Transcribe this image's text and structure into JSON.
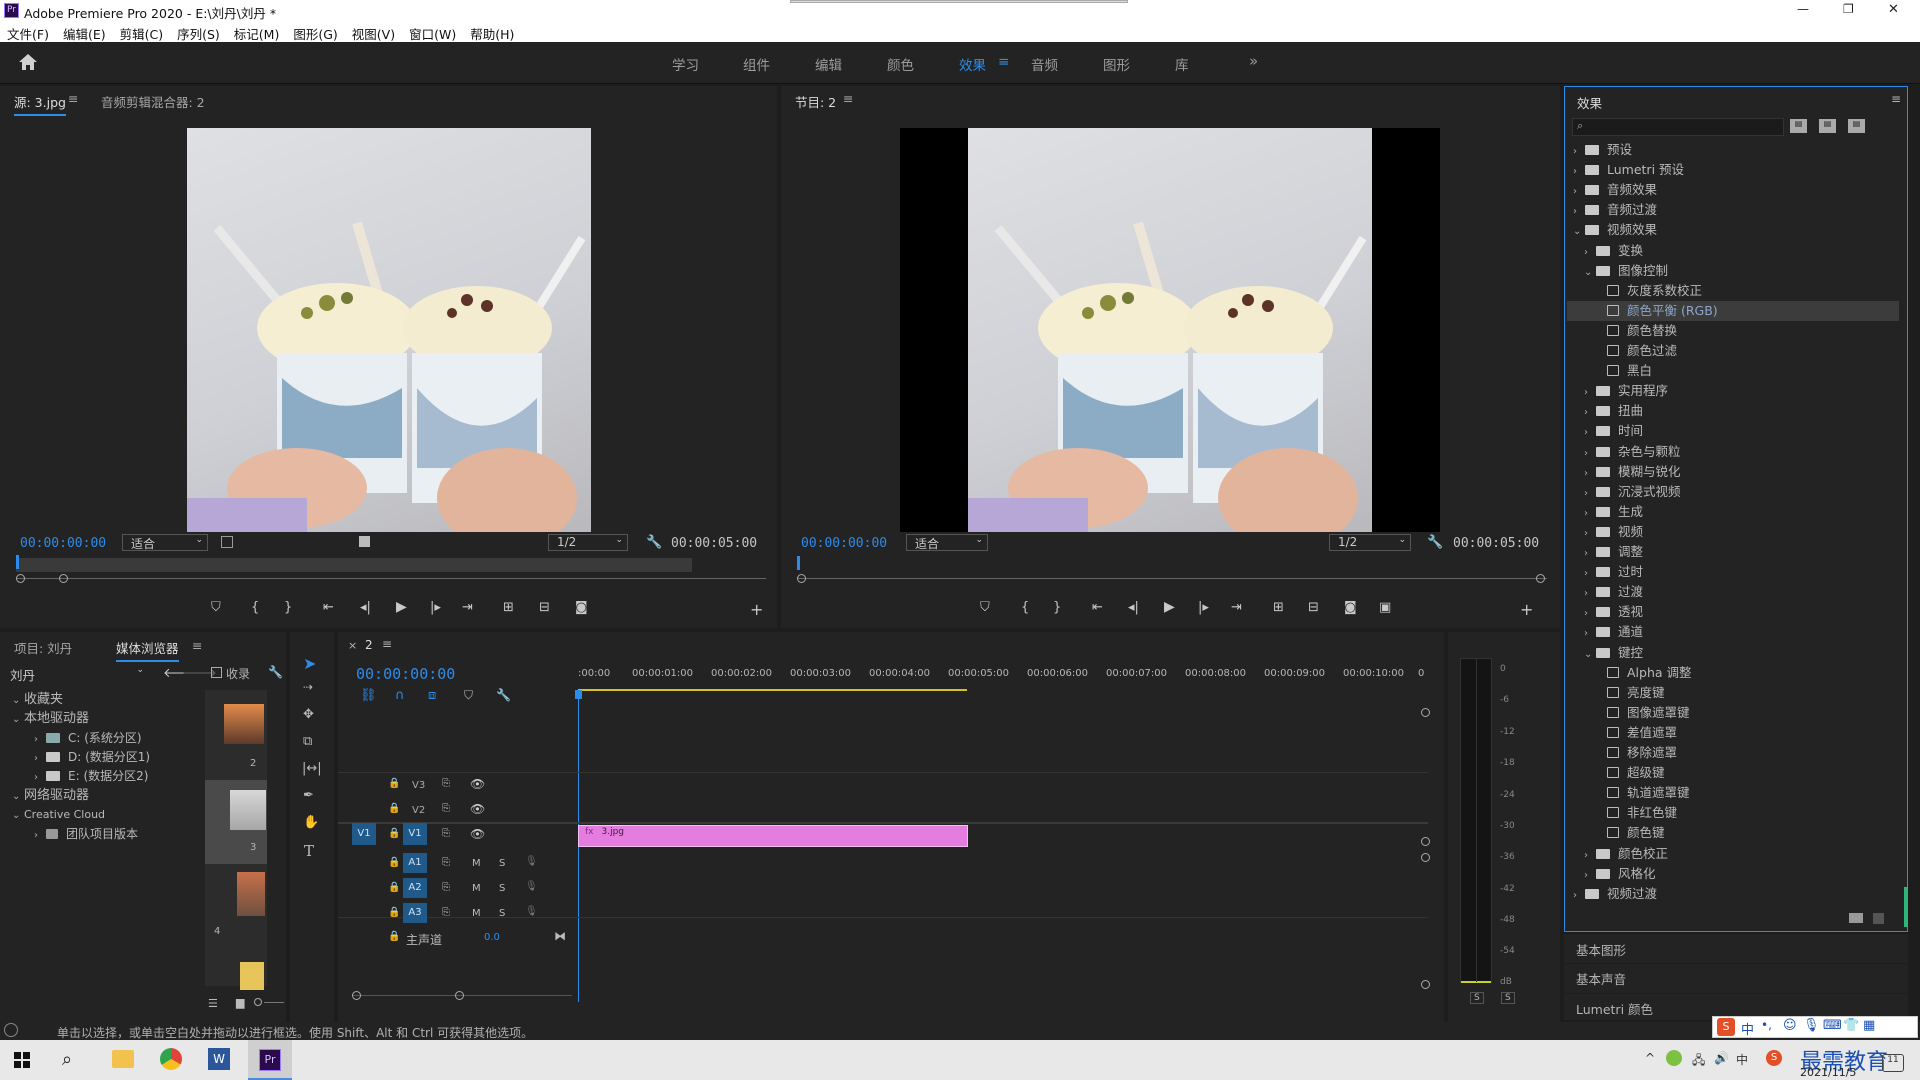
{
  "window": {
    "title": "Adobe Premiere Pro 2020 - E:\\刘丹\\刘丹 *",
    "controls": [
      "—",
      "❐",
      "✕"
    ]
  },
  "menu": [
    "文件(F)",
    "编辑(E)",
    "剪辑(C)",
    "序列(S)",
    "标记(M)",
    "图形(G)",
    "视图(V)",
    "窗口(W)",
    "帮助(H)"
  ],
  "workspaces": [
    "学习",
    "组件",
    "编辑",
    "颜色",
    "效果",
    "音频",
    "图形",
    "库"
  ],
  "active_workspace": "效果",
  "source": {
    "tab": "源: 3.jpg",
    "tab2": "音频剪辑混合器: 2",
    "timecode": "00:00:00:00",
    "fit": "适合",
    "res": "1/2",
    "duration": "00:00:05:00"
  },
  "program": {
    "tab": "节目: 2",
    "timecode": "00:00:00:00",
    "fit": "适合",
    "res": "1/2",
    "duration": "00:00:05:00"
  },
  "project": {
    "tab1": "项目: 刘丹",
    "tab2": "媒体浏览器",
    "location": "刘丹",
    "fav_label": "收录",
    "tree": [
      {
        "label": "收藏夹",
        "level": 0,
        "expanded": true
      },
      {
        "label": "本地驱动器",
        "level": 0,
        "expanded": true
      },
      {
        "label": "C: (系统分区)",
        "level": 1
      },
      {
        "label": "D: (数据分区1)",
        "level": 1
      },
      {
        "label": "E: (数据分区2)",
        "level": 1
      },
      {
        "label": "网络驱动器",
        "level": 0,
        "expanded": true
      },
      {
        "label": "Creative Cloud",
        "level": 0,
        "expanded": true
      },
      {
        "label": "团队项目版本",
        "level": 1
      }
    ],
    "thumb_nums": [
      "2",
      "3",
      "4"
    ]
  },
  "timeline": {
    "tab": "2",
    "timecode": "00:00:00:00",
    "ruler": [
      ":00:00",
      "00:00:01:00",
      "00:00:02:00",
      "00:00:03:00",
      "00:00:04:00",
      "00:00:05:00",
      "00:00:06:00",
      "00:00:07:00",
      "00:00:08:00",
      "00:00:09:00",
      "00:00:10:00",
      "0"
    ],
    "video_tracks": [
      "V3",
      "V2",
      "V1"
    ],
    "audio_tracks": [
      "A1",
      "A2",
      "A3"
    ],
    "master": "主声道",
    "master_val": "0.0",
    "clip": "3.jpg",
    "src_patch": "V1",
    "M": "M",
    "S": "S",
    "fx": "fx"
  },
  "meter": {
    "db": [
      "0",
      "-6",
      "-12",
      "-18",
      "-24",
      "-30",
      "-36",
      "-42",
      "-48",
      "-54",
      "dB"
    ],
    "solo": [
      "S",
      "S"
    ]
  },
  "effects": {
    "title": "效果",
    "items": [
      {
        "label": "预设",
        "level": 0,
        "type": "folder",
        "open": false
      },
      {
        "label": "Lumetri 预设",
        "level": 0,
        "type": "folder",
        "open": false
      },
      {
        "label": "音频效果",
        "level": 0,
        "type": "folder",
        "open": false
      },
      {
        "label": "音频过渡",
        "level": 0,
        "type": "folder",
        "open": false
      },
      {
        "label": "视频效果",
        "level": 0,
        "type": "folder",
        "open": true
      },
      {
        "label": "变换",
        "level": 1,
        "type": "folder",
        "open": false
      },
      {
        "label": "图像控制",
        "level": 1,
        "type": "folder",
        "open": true
      },
      {
        "label": "灰度系数校正",
        "level": 2,
        "type": "fx"
      },
      {
        "label": "颜色平衡 (RGB)",
        "level": 2,
        "type": "fx",
        "selected": true
      },
      {
        "label": "颜色替换",
        "level": 2,
        "type": "fx"
      },
      {
        "label": "颜色过滤",
        "level": 2,
        "type": "fx"
      },
      {
        "label": "黑白",
        "level": 2,
        "type": "fx"
      },
      {
        "label": "实用程序",
        "level": 1,
        "type": "folder",
        "open": false
      },
      {
        "label": "扭曲",
        "level": 1,
        "type": "folder",
        "open": false
      },
      {
        "label": "时间",
        "level": 1,
        "type": "folder",
        "open": false
      },
      {
        "label": "杂色与颗粒",
        "level": 1,
        "type": "folder",
        "open": false
      },
      {
        "label": "模糊与锐化",
        "level": 1,
        "type": "folder",
        "open": false
      },
      {
        "label": "沉浸式视频",
        "level": 1,
        "type": "folder",
        "open": false
      },
      {
        "label": "生成",
        "level": 1,
        "type": "folder",
        "open": false
      },
      {
        "label": "视频",
        "level": 1,
        "type": "folder",
        "open": false
      },
      {
        "label": "调整",
        "level": 1,
        "type": "folder",
        "open": false
      },
      {
        "label": "过时",
        "level": 1,
        "type": "folder",
        "open": false
      },
      {
        "label": "过渡",
        "level": 1,
        "type": "folder",
        "open": false
      },
      {
        "label": "透视",
        "level": 1,
        "type": "folder",
        "open": false
      },
      {
        "label": "通道",
        "level": 1,
        "type": "folder",
        "open": false
      },
      {
        "label": "键控",
        "level": 1,
        "type": "folder",
        "open": true
      },
      {
        "label": "Alpha 调整",
        "level": 2,
        "type": "fx"
      },
      {
        "label": "亮度键",
        "level": 2,
        "type": "fx"
      },
      {
        "label": "图像遮罩键",
        "level": 2,
        "type": "fx"
      },
      {
        "label": "差值遮罩",
        "level": 2,
        "type": "fx"
      },
      {
        "label": "移除遮罩",
        "level": 2,
        "type": "fx"
      },
      {
        "label": "超级键",
        "level": 2,
        "type": "fx"
      },
      {
        "label": "轨道遮罩键",
        "level": 2,
        "type": "fx"
      },
      {
        "label": "非红色键",
        "level": 2,
        "type": "fx"
      },
      {
        "label": "颜色键",
        "level": 2,
        "type": "fx"
      },
      {
        "label": "颜色校正",
        "level": 1,
        "type": "folder",
        "open": false
      },
      {
        "label": "风格化",
        "level": 1,
        "type": "folder",
        "open": false
      },
      {
        "label": "视频过渡",
        "level": 0,
        "type": "folder",
        "open": false
      }
    ],
    "sections": [
      "基本图形",
      "基本声音",
      "Lumetri 颜色"
    ]
  },
  "status": "单击以选择，或单击空白处并拖动以进行框选。使用 Shift、Alt 和 Ctrl 可获得其他选项。",
  "taskbar": {
    "time": "2021/11/5",
    "brand": "最需教育",
    "ime": "中"
  }
}
